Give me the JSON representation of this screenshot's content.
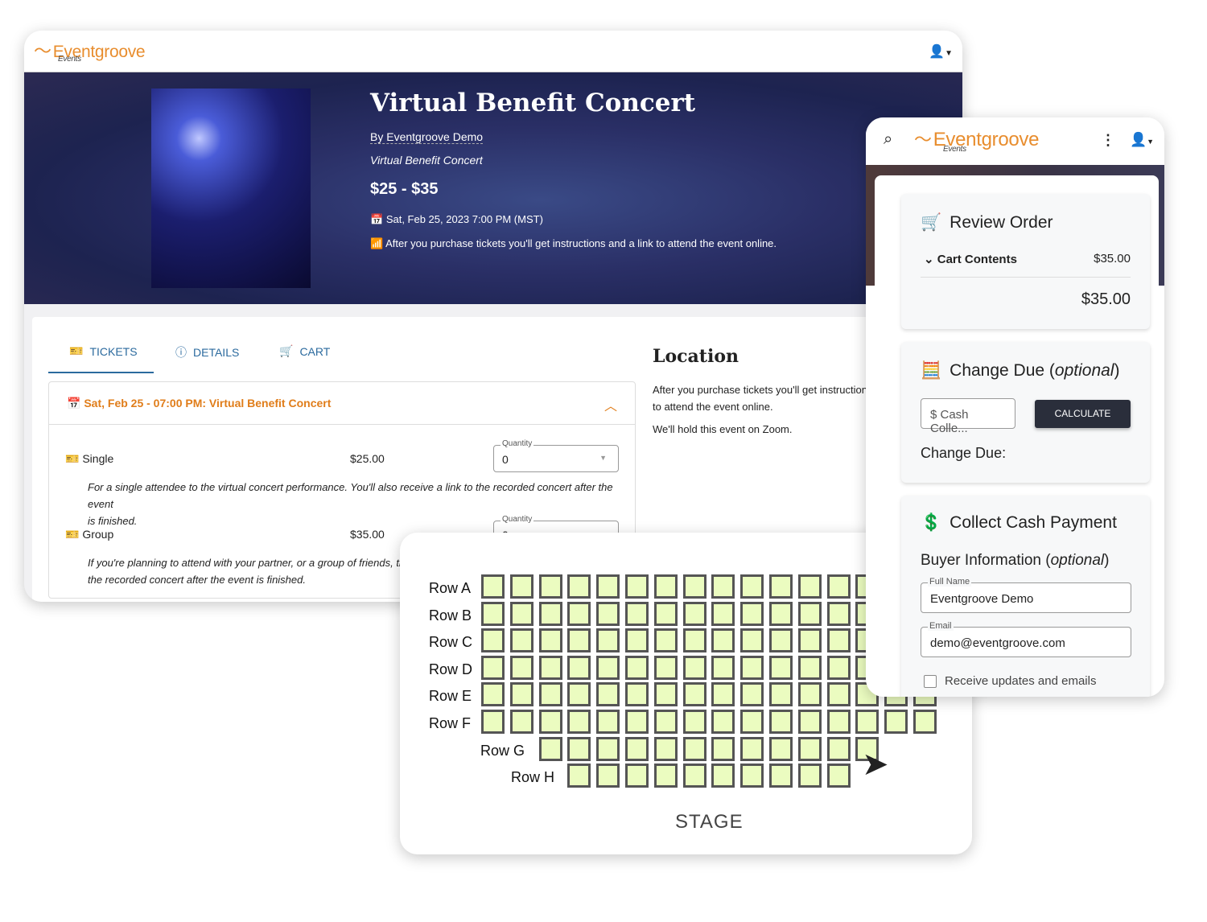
{
  "brand": {
    "name": "Eventgroove",
    "sub": "Events",
    "color": "#e88d2e"
  },
  "event": {
    "title": "Virtual Benefit Concert",
    "by": "By Eventgroove Demo",
    "subtitle": "Virtual Benefit Concert",
    "price": "$25 - $35",
    "date": "Sat, Feb 25, 2023 7:00 PM (MST)",
    "online_note": "After you purchase tickets you'll get instructions and a link to attend the event online."
  },
  "tabs": [
    {
      "label": "TICKETS",
      "icon": "ticket-icon"
    },
    {
      "label": "DETAILS",
      "icon": "info-icon"
    },
    {
      "label": "CART",
      "icon": "cart-icon"
    }
  ],
  "session": {
    "label": "Sat, Feb 25 - 07:00 PM: Virtual Benefit Concert"
  },
  "tickets": [
    {
      "name": "Single",
      "price": "$25.00",
      "qty_label": "Quantity",
      "qty": "0",
      "desc1": "For a single attendee to the virtual concert performance. You'll also receive a link to the recorded concert after the event",
      "desc2": "is finished."
    },
    {
      "name": "Group",
      "price": "$35.00",
      "qty_label": "Quantity",
      "qty": "0",
      "desc1": "If you're planning to attend with your partner, or a group of friends, thi",
      "desc2": "the recorded concert after the event is finished."
    }
  ],
  "location": {
    "title": "Location",
    "text1": "After you purchase tickets you'll get instructions and a link",
    "text2": "to attend the event online.",
    "text3": "We'll hold this event on Zoom."
  },
  "seating": {
    "stage": "STAGE",
    "seat_color": "#ebfcc0",
    "rows": [
      {
        "label": "Row A",
        "start": 0,
        "count": 16
      },
      {
        "label": "Row B",
        "start": 0,
        "count": 16
      },
      {
        "label": "Row C",
        "start": 0,
        "count": 16
      },
      {
        "label": "Row D",
        "start": 0,
        "count": 16
      },
      {
        "label": "Row E",
        "start": 0,
        "count": 16
      },
      {
        "label": "Row F",
        "start": 0,
        "count": 16
      },
      {
        "label": "Row G",
        "start": 2,
        "count": 12
      },
      {
        "label": "Row H",
        "start": 3,
        "count": 10
      }
    ]
  },
  "phone": {
    "review": {
      "title": "Review Order",
      "cart_label": "Cart Contents",
      "cart_amount": "$35.00",
      "total": "$35.00"
    },
    "change": {
      "title": "Change Due",
      "optional": "optional",
      "cash_placeholder": "$ Cash Colle...",
      "calc": "CALCULATE",
      "due_label": "Change Due:"
    },
    "collect": {
      "title": "Collect Cash Payment",
      "buyer": "Buyer Information",
      "optional": "optional",
      "name_label": "Full Name",
      "name": "Eventgroove Demo",
      "email_label": "Email",
      "email": "demo@eventgroove.com",
      "updates": "Receive updates and emails"
    }
  }
}
